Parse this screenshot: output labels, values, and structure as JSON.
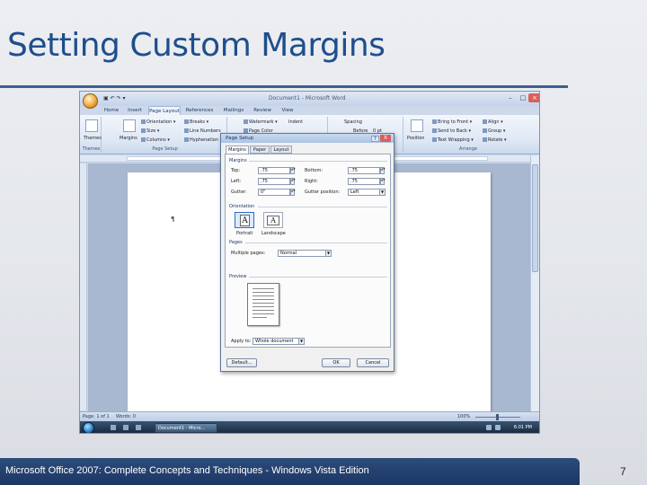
{
  "slide": {
    "title": "Setting Custom Margins",
    "footer": "Microsoft Office 2007: Complete Concepts and Techniques - Windows Vista Edition",
    "page_number": "7"
  },
  "window": {
    "title": "Document1 - Microsoft Word",
    "tabs": [
      "Home",
      "Insert",
      "Page Layout",
      "References",
      "Mailings",
      "Review",
      "View"
    ],
    "active_tab": "Page Layout"
  },
  "ribbon": {
    "themes_group": {
      "label": "Themes",
      "button": "Themes"
    },
    "page_setup_group": {
      "label": "Page Setup",
      "margins": "Margins",
      "orientation": "Orientation",
      "size": "Size",
      "columns": "Columns",
      "breaks": "Breaks",
      "line_numbers": "Line Numbers",
      "hyphenation": "Hyphenation"
    },
    "page_background": {
      "watermark": "Watermark",
      "page_color": "Page Color"
    },
    "paragraph": {
      "indent": "Indent",
      "spacing": "Spacing",
      "before": "Before",
      "before_value": "0 pt"
    },
    "arrange_group": {
      "label": "Arrange",
      "position": "Position",
      "bring_to_front": "Bring to Front",
      "send_to_back": "Send to Back",
      "text_wrapping": "Text Wrapping",
      "align": "Align",
      "group": "Group",
      "rotate": "Rotate"
    }
  },
  "document": {
    "paragraph_mark": "¶"
  },
  "status_bar": {
    "page": "Page: 1 of 1",
    "words": "Words: 0",
    "zoom": "100%"
  },
  "taskbar": {
    "task": "Document1 - Micro...",
    "clock": "6:01 PM"
  },
  "dialog": {
    "title": "Page Setup",
    "help": "?",
    "close": "X",
    "tabs": [
      "Margins",
      "Paper",
      "Layout"
    ],
    "active_tab": "Margins",
    "margins_section": "Margins",
    "top_label": "Top:",
    "top_value": ".75",
    "bottom_label": "Bottom:",
    "bottom_value": ".75",
    "left_label": "Left:",
    "left_value": ".75",
    "right_label": "Right:",
    "right_value": ".75",
    "gutter_label": "Gutter:",
    "gutter_value": "0\"",
    "gutter_position_label": "Gutter position:",
    "gutter_position_value": "Left",
    "orientation_section": "Orientation",
    "portrait_label": "Portrait",
    "landscape_label": "Landscape",
    "orientation_glyph": "A",
    "pages_section": "Pages",
    "multiple_pages_label": "Multiple pages:",
    "multiple_pages_value": "Normal",
    "preview_section": "Preview",
    "apply_to_label": "Apply to:",
    "apply_to_value": "Whole document",
    "default_button": "Default...",
    "ok_button": "OK",
    "cancel_button": "Cancel"
  },
  "colors": {
    "accent": "#1f4e8c",
    "footer": "#1c3663",
    "ribbon": "#dde7f4"
  }
}
